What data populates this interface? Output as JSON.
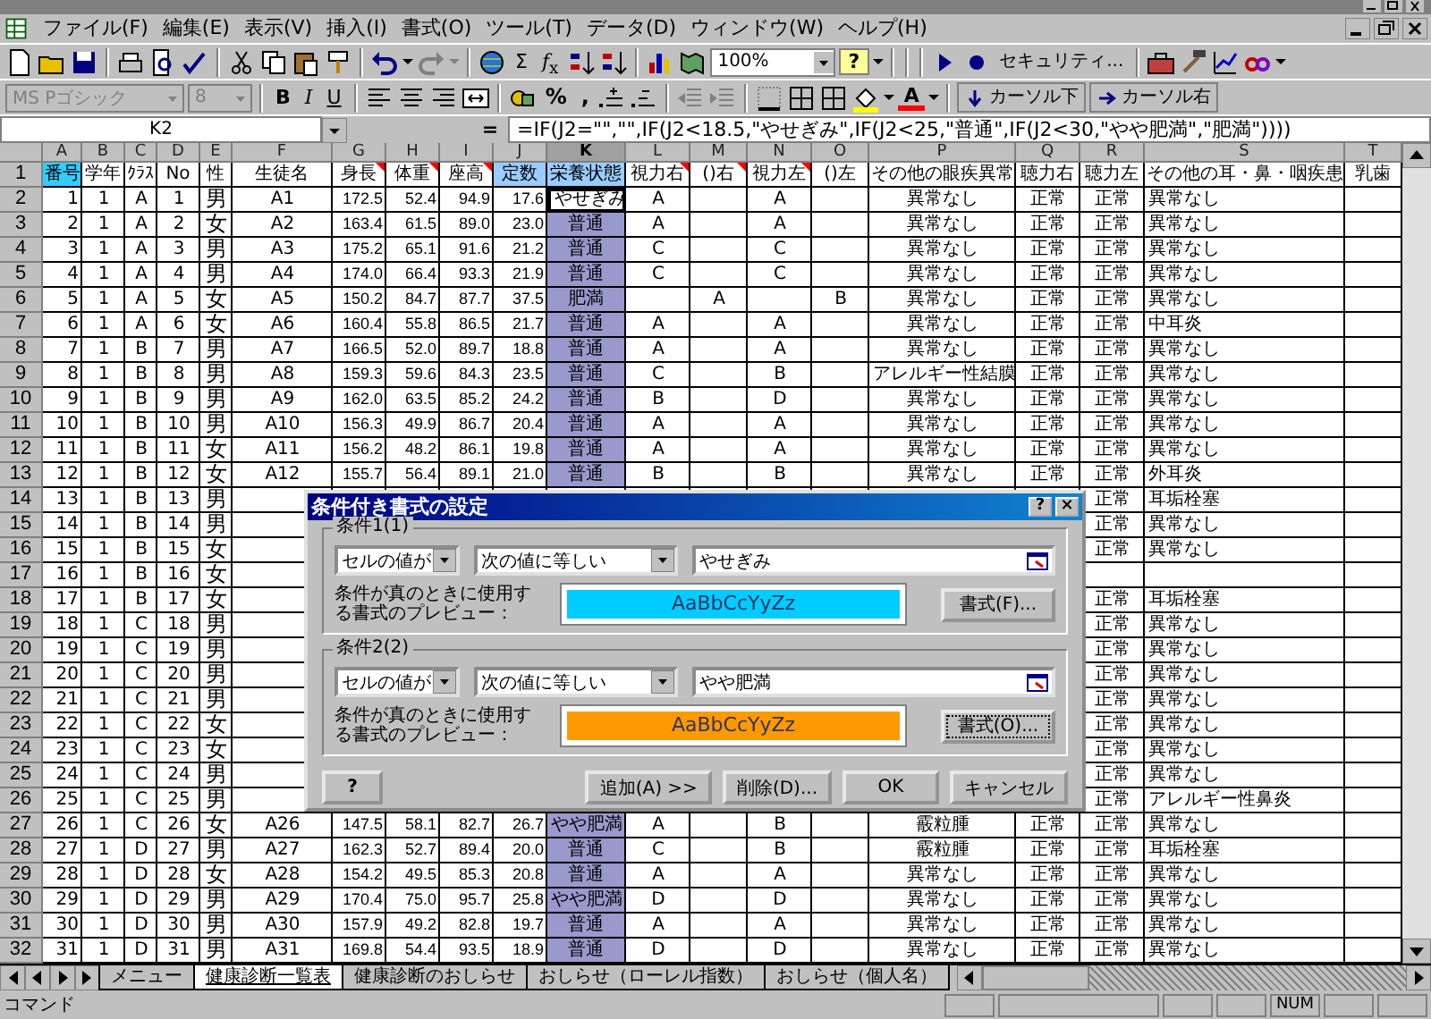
{
  "menu": [
    "ファイル(F)",
    "編集(E)",
    "表示(V)",
    "挿入(I)",
    "書式(O)",
    "ツール(T)",
    "データ(D)",
    "ウィンドウ(W)",
    "ヘルプ(H)"
  ],
  "toolbar": {
    "sum": "Σ",
    "function": "*f*$_{x}$",
    "zoom": "100%",
    "help": "?",
    "security": "セキュリティ..."
  },
  "format_bar": {
    "font": "MS Pゴシック",
    "size": "8",
    "disabled": true,
    "styles": [
      "B",
      "I",
      "U"
    ],
    "percent": "%",
    "comma": ",",
    "font_color": "A",
    "cursor_down": "カーソル下",
    "cursor_right": "カーソル右"
  },
  "formula_bar": {
    "name_box": "K2",
    "equals": "=",
    "formula": "=IF(J2=\"\",\"\",IF(J2<18.5,\"やせぎみ\",IF(J2<25,\"普通\",IF(J2<30,\"やや肥満\",\"肥満\"))))"
  },
  "columns": [
    {
      "letter": "A",
      "selected": false,
      "note": false,
      "color": "#33ccff"
    },
    {
      "letter": "B",
      "selected": false,
      "note": false
    },
    {
      "letter": "C",
      "selected": false,
      "note": false
    },
    {
      "letter": "D",
      "selected": false,
      "note": false
    },
    {
      "letter": "E",
      "selected": false,
      "note": false
    },
    {
      "letter": "F",
      "selected": false,
      "note": false
    },
    {
      "letter": "G",
      "selected": false,
      "note": true
    },
    {
      "letter": "H",
      "selected": false,
      "note": true
    },
    {
      "letter": "I",
      "selected": false,
      "note": true
    },
    {
      "letter": "J",
      "selected": false,
      "note": false,
      "color": "#99ccff"
    },
    {
      "letter": "K",
      "selected": true,
      "note": false,
      "color": "#99ccff"
    },
    {
      "letter": "L",
      "selected": false,
      "note": true
    },
    {
      "letter": "M",
      "selected": false,
      "note": true
    },
    {
      "letter": "N",
      "selected": false,
      "note": true
    },
    {
      "letter": "O",
      "selected": false,
      "note": false
    },
    {
      "letter": "P",
      "selected": false,
      "note": false
    },
    {
      "letter": "Q",
      "selected": false,
      "note": false
    },
    {
      "letter": "R",
      "selected": false,
      "note": false
    },
    {
      "letter": "S",
      "selected": false,
      "note": false
    },
    {
      "letter": "T",
      "selected": false,
      "note": false
    }
  ],
  "rows": [
    {
      "kind": "header",
      "number": "1",
      "cells": [
        {
          "text": "番号",
          "active": false
        },
        {
          "text": "学年",
          "active": false
        },
        {
          "text": "ｸﾗｽ",
          "active": false
        },
        {
          "text": "No",
          "active": false
        },
        {
          "text": "性",
          "active": false
        },
        {
          "text": "生徒名",
          "active": false
        },
        {
          "text": "身長",
          "active": false
        },
        {
          "text": "体重",
          "active": false
        },
        {
          "text": "座高",
          "active": false
        },
        {
          "text": "定数",
          "active": false
        },
        {
          "text": "栄養状態",
          "active": false
        },
        {
          "text": "視力右",
          "active": false
        },
        {
          "text": "()右",
          "active": false
        },
        {
          "text": "視力左",
          "active": false
        },
        {
          "text": "()左",
          "active": false
        },
        {
          "text": "その他の眼疾異常",
          "active": false
        },
        {
          "text": "聴力右",
          "active": false
        },
        {
          "text": "聴力左",
          "active": false
        },
        {
          "text": "その他の耳・鼻・咽疾患",
          "active": false
        },
        {
          "text": "乳歯",
          "active": false
        }
      ]
    },
    {
      "kind": "data",
      "number": "2",
      "cells": [
        {
          "text": "1",
          "active": false
        },
        {
          "text": "1",
          "active": false
        },
        {
          "text": "A",
          "active": false
        },
        {
          "text": "1",
          "active": false
        },
        {
          "text": "男",
          "active": false
        },
        {
          "text": "A1",
          "active": false
        },
        {
          "text": "172.5",
          "active": false
        },
        {
          "text": "52.4",
          "active": false
        },
        {
          "text": "94.9",
          "active": false
        },
        {
          "text": "17.6",
          "active": false
        },
        {
          "text": "やせぎみ",
          "active": true
        },
        {
          "text": "A",
          "active": false
        },
        null,
        {
          "text": "A",
          "active": false
        },
        null,
        {
          "text": "異常なし",
          "active": false
        },
        {
          "text": "正常",
          "active": false
        },
        {
          "text": "正常",
          "active": false
        },
        {
          "text": "異常なし",
          "active": false
        },
        null
      ]
    },
    {
      "kind": "data",
      "number": "3",
      "cells": [
        {
          "text": "2",
          "active": false
        },
        {
          "text": "1",
          "active": false
        },
        {
          "text": "A",
          "active": false
        },
        {
          "text": "2",
          "active": false
        },
        {
          "text": "女",
          "active": false
        },
        {
          "text": "A2",
          "active": false
        },
        {
          "text": "163.4",
          "active": false
        },
        {
          "text": "61.5",
          "active": false
        },
        {
          "text": "89.0",
          "active": false
        },
        {
          "text": "23.0",
          "active": false
        },
        {
          "text": "普通",
          "active": false
        },
        {
          "text": "A",
          "active": false
        },
        null,
        {
          "text": "A",
          "active": false
        },
        null,
        {
          "text": "異常なし",
          "active": false
        },
        {
          "text": "正常",
          "active": false
        },
        {
          "text": "正常",
          "active": false
        },
        {
          "text": "異常なし",
          "active": false
        },
        null
      ]
    },
    {
      "kind": "data",
      "number": "4",
      "cells": [
        {
          "text": "3",
          "active": false
        },
        {
          "text": "1",
          "active": false
        },
        {
          "text": "A",
          "active": false
        },
        {
          "text": "3",
          "active": false
        },
        {
          "text": "男",
          "active": false
        },
        {
          "text": "A3",
          "active": false
        },
        {
          "text": "175.2",
          "active": false
        },
        {
          "text": "65.1",
          "active": false
        },
        {
          "text": "91.6",
          "active": false
        },
        {
          "text": "21.2",
          "active": false
        },
        {
          "text": "普通",
          "active": false
        },
        {
          "text": "C",
          "active": false
        },
        null,
        {
          "text": "C",
          "active": false
        },
        null,
        {
          "text": "異常なし",
          "active": false
        },
        {
          "text": "正常",
          "active": false
        },
        {
          "text": "正常",
          "active": false
        },
        {
          "text": "異常なし",
          "active": false
        },
        null
      ]
    },
    {
      "kind": "data",
      "number": "5",
      "cells": [
        {
          "text": "4",
          "active": false
        },
        {
          "text": "1",
          "active": false
        },
        {
          "text": "A",
          "active": false
        },
        {
          "text": "4",
          "active": false
        },
        {
          "text": "男",
          "active": false
        },
        {
          "text": "A4",
          "active": false
        },
        {
          "text": "174.0",
          "active": false
        },
        {
          "text": "66.4",
          "active": false
        },
        {
          "text": "93.3",
          "active": false
        },
        {
          "text": "21.9",
          "active": false
        },
        {
          "text": "普通",
          "active": false
        },
        {
          "text": "C",
          "active": false
        },
        null,
        {
          "text": "C",
          "active": false
        },
        null,
        {
          "text": "異常なし",
          "active": false
        },
        {
          "text": "正常",
          "active": false
        },
        {
          "text": "正常",
          "active": false
        },
        {
          "text": "異常なし",
          "active": false
        },
        null
      ]
    },
    {
      "kind": "data",
      "number": "6",
      "cells": [
        {
          "text": "5",
          "active": false
        },
        {
          "text": "1",
          "active": false
        },
        {
          "text": "A",
          "active": false
        },
        {
          "text": "5",
          "active": false
        },
        {
          "text": "女",
          "active": false
        },
        {
          "text": "A5",
          "active": false
        },
        {
          "text": "150.2",
          "active": false
        },
        {
          "text": "84.7",
          "active": false
        },
        {
          "text": "87.7",
          "active": false
        },
        {
          "text": "37.5",
          "active": false
        },
        {
          "text": "肥満",
          "active": false
        },
        null,
        {
          "text": "A",
          "active": false
        },
        null,
        {
          "text": "B",
          "active": false
        },
        {
          "text": "異常なし",
          "active": false
        },
        {
          "text": "正常",
          "active": false
        },
        {
          "text": "正常",
          "active": false
        },
        {
          "text": "異常なし",
          "active": false
        },
        null
      ]
    },
    {
      "kind": "data",
      "number": "7",
      "cells": [
        {
          "text": "6",
          "active": false
        },
        {
          "text": "1",
          "active": false
        },
        {
          "text": "A",
          "active": false
        },
        {
          "text": "6",
          "active": false
        },
        {
          "text": "女",
          "active": false
        },
        {
          "text": "A6",
          "active": false
        },
        {
          "text": "160.4",
          "active": false
        },
        {
          "text": "55.8",
          "active": false
        },
        {
          "text": "86.5",
          "active": false
        },
        {
          "text": "21.7",
          "active": false
        },
        {
          "text": "普通",
          "active": false
        },
        {
          "text": "A",
          "active": false
        },
        null,
        {
          "text": "A",
          "active": false
        },
        null,
        {
          "text": "異常なし",
          "active": false
        },
        {
          "text": "正常",
          "active": false
        },
        {
          "text": "正常",
          "active": false
        },
        {
          "text": "中耳炎",
          "active": false
        },
        null
      ]
    },
    {
      "kind": "data",
      "number": "8",
      "cells": [
        {
          "text": "7",
          "active": false
        },
        {
          "text": "1",
          "active": false
        },
        {
          "text": "B",
          "active": false
        },
        {
          "text": "7",
          "active": false
        },
        {
          "text": "男",
          "active": false
        },
        {
          "text": "A7",
          "active": false
        },
        {
          "text": "166.5",
          "active": false
        },
        {
          "text": "52.0",
          "active": false
        },
        {
          "text": "89.7",
          "active": false
        },
        {
          "text": "18.8",
          "active": false
        },
        {
          "text": "普通",
          "active": false
        },
        {
          "text": "A",
          "active": false
        },
        null,
        {
          "text": "A",
          "active": false
        },
        null,
        {
          "text": "異常なし",
          "active": false
        },
        {
          "text": "正常",
          "active": false
        },
        {
          "text": "正常",
          "active": false
        },
        {
          "text": "異常なし",
          "active": false
        },
        null
      ]
    },
    {
      "kind": "data",
      "number": "9",
      "cells": [
        {
          "text": "8",
          "active": false
        },
        {
          "text": "1",
          "active": false
        },
        {
          "text": "B",
          "active": false
        },
        {
          "text": "8",
          "active": false
        },
        {
          "text": "男",
          "active": false
        },
        {
          "text": "A8",
          "active": false
        },
        {
          "text": "159.3",
          "active": false
        },
        {
          "text": "59.6",
          "active": false
        },
        {
          "text": "84.3",
          "active": false
        },
        {
          "text": "23.5",
          "active": false
        },
        {
          "text": "普通",
          "active": false
        },
        {
          "text": "C",
          "active": false
        },
        null,
        {
          "text": "B",
          "active": false
        },
        null,
        {
          "text": "アレルギー性結膜",
          "active": false
        },
        {
          "text": "正常",
          "active": false
        },
        {
          "text": "正常",
          "active": false
        },
        {
          "text": "異常なし",
          "active": false
        },
        null
      ]
    },
    {
      "kind": "data",
      "number": "10",
      "cells": [
        {
          "text": "9",
          "active": false
        },
        {
          "text": "1",
          "active": false
        },
        {
          "text": "B",
          "active": false
        },
        {
          "text": "9",
          "active": false
        },
        {
          "text": "男",
          "active": false
        },
        {
          "text": "A9",
          "active": false
        },
        {
          "text": "162.0",
          "active": false
        },
        {
          "text": "63.5",
          "active": false
        },
        {
          "text": "85.2",
          "active": false
        },
        {
          "text": "24.2",
          "active": false
        },
        {
          "text": "普通",
          "active": false
        },
        {
          "text": "B",
          "active": false
        },
        null,
        {
          "text": "D",
          "active": false
        },
        null,
        {
          "text": "異常なし",
          "active": false
        },
        {
          "text": "正常",
          "active": false
        },
        {
          "text": "正常",
          "active": false
        },
        {
          "text": "異常なし",
          "active": false
        },
        null
      ]
    },
    {
      "kind": "data",
      "number": "11",
      "cells": [
        {
          "text": "10",
          "active": false
        },
        {
          "text": "1",
          "active": false
        },
        {
          "text": "B",
          "active": false
        },
        {
          "text": "10",
          "active": false
        },
        {
          "text": "男",
          "active": false
        },
        {
          "text": "A10",
          "active": false
        },
        {
          "text": "156.3",
          "active": false
        },
        {
          "text": "49.9",
          "active": false
        },
        {
          "text": "86.7",
          "active": false
        },
        {
          "text": "20.4",
          "active": false
        },
        {
          "text": "普通",
          "active": false
        },
        {
          "text": "A",
          "active": false
        },
        null,
        {
          "text": "A",
          "active": false
        },
        null,
        {
          "text": "異常なし",
          "active": false
        },
        {
          "text": "正常",
          "active": false
        },
        {
          "text": "正常",
          "active": false
        },
        {
          "text": "異常なし",
          "active": false
        },
        null
      ]
    },
    {
      "kind": "data",
      "number": "12",
      "cells": [
        {
          "text": "11",
          "active": false
        },
        {
          "text": "1",
          "active": false
        },
        {
          "text": "B",
          "active": false
        },
        {
          "text": "11",
          "active": false
        },
        {
          "text": "女",
          "active": false
        },
        {
          "text": "A11",
          "active": false
        },
        {
          "text": "156.2",
          "active": false
        },
        {
          "text": "48.2",
          "active": false
        },
        {
          "text": "86.1",
          "active": false
        },
        {
          "text": "19.8",
          "active": false
        },
        {
          "text": "普通",
          "active": false
        },
        {
          "text": "A",
          "active": false
        },
        null,
        {
          "text": "A",
          "active": false
        },
        null,
        {
          "text": "異常なし",
          "active": false
        },
        {
          "text": "正常",
          "active": false
        },
        {
          "text": "正常",
          "active": false
        },
        {
          "text": "異常なし",
          "active": false
        },
        null
      ]
    },
    {
      "kind": "data",
      "number": "13",
      "cells": [
        {
          "text": "12",
          "active": false
        },
        {
          "text": "1",
          "active": false
        },
        {
          "text": "B",
          "active": false
        },
        {
          "text": "12",
          "active": false
        },
        {
          "text": "女",
          "active": false
        },
        {
          "text": "A12",
          "active": false
        },
        {
          "text": "155.7",
          "active": false
        },
        {
          "text": "56.4",
          "active": false
        },
        {
          "text": "89.1",
          "active": false
        },
        {
          "text": "21.0",
          "active": false
        },
        {
          "text": "普通",
          "active": false
        },
        {
          "text": "B",
          "active": false
        },
        null,
        {
          "text": "B",
          "active": false
        },
        null,
        {
          "text": "異常なし",
          "active": false
        },
        {
          "text": "正常",
          "active": false
        },
        {
          "text": "正常",
          "active": false
        },
        {
          "text": "外耳炎",
          "active": false
        },
        null
      ]
    },
    {
      "kind": "data",
      "number": "14",
      "cells": [
        {
          "text": "13",
          "active": false
        },
        {
          "text": "1",
          "active": false
        },
        {
          "text": "B",
          "active": false
        },
        {
          "text": "13",
          "active": false
        },
        {
          "text": "男",
          "active": false
        },
        null,
        null,
        null,
        null,
        null,
        null,
        null,
        null,
        null,
        null,
        null,
        null,
        {
          "text": "正常",
          "active": false
        },
        {
          "text": "耳垢栓塞",
          "active": false
        },
        null
      ]
    },
    {
      "kind": "data",
      "number": "15",
      "cells": [
        {
          "text": "14",
          "active": false
        },
        {
          "text": "1",
          "active": false
        },
        {
          "text": "B",
          "active": false
        },
        {
          "text": "14",
          "active": false
        },
        {
          "text": "男",
          "active": false
        },
        null,
        null,
        null,
        null,
        null,
        null,
        null,
        null,
        null,
        null,
        null,
        null,
        {
          "text": "正常",
          "active": false
        },
        {
          "text": "異常なし",
          "active": false
        },
        null
      ]
    },
    {
      "kind": "data",
      "number": "16",
      "cells": [
        {
          "text": "15",
          "active": false
        },
        {
          "text": "1",
          "active": false
        },
        {
          "text": "B",
          "active": false
        },
        {
          "text": "15",
          "active": false
        },
        {
          "text": "女",
          "active": false
        },
        null,
        null,
        null,
        null,
        null,
        null,
        null,
        null,
        null,
        null,
        null,
        null,
        {
          "text": "正常",
          "active": false
        },
        {
          "text": "異常なし",
          "active": false
        },
        null
      ]
    },
    {
      "kind": "data",
      "number": "17",
      "cells": [
        {
          "text": "16",
          "active": false
        },
        {
          "text": "1",
          "active": false
        },
        {
          "text": "B",
          "active": false
        },
        {
          "text": "16",
          "active": false
        },
        {
          "text": "女",
          "active": false
        },
        null,
        null,
        null,
        null,
        null,
        null,
        null,
        null,
        null,
        null,
        null,
        null,
        null,
        null,
        null
      ]
    },
    {
      "kind": "data",
      "number": "18",
      "cells": [
        {
          "text": "17",
          "active": false
        },
        {
          "text": "1",
          "active": false
        },
        {
          "text": "B",
          "active": false
        },
        {
          "text": "17",
          "active": false
        },
        {
          "text": "女",
          "active": false
        },
        null,
        null,
        null,
        null,
        null,
        null,
        null,
        null,
        null,
        null,
        null,
        null,
        {
          "text": "正常",
          "active": false
        },
        {
          "text": "耳垢栓塞",
          "active": false
        },
        null
      ]
    },
    {
      "kind": "data",
      "number": "19",
      "cells": [
        {
          "text": "18",
          "active": false
        },
        {
          "text": "1",
          "active": false
        },
        {
          "text": "C",
          "active": false
        },
        {
          "text": "18",
          "active": false
        },
        {
          "text": "男",
          "active": false
        },
        null,
        null,
        null,
        null,
        null,
        null,
        null,
        null,
        null,
        null,
        null,
        null,
        {
          "text": "正常",
          "active": false
        },
        {
          "text": "異常なし",
          "active": false
        },
        null
      ]
    },
    {
      "kind": "data",
      "number": "20",
      "cells": [
        {
          "text": "19",
          "active": false
        },
        {
          "text": "1",
          "active": false
        },
        {
          "text": "C",
          "active": false
        },
        {
          "text": "19",
          "active": false
        },
        {
          "text": "男",
          "active": false
        },
        null,
        null,
        null,
        null,
        null,
        null,
        null,
        null,
        null,
        null,
        null,
        null,
        {
          "text": "正常",
          "active": false
        },
        {
          "text": "異常なし",
          "active": false
        },
        null
      ]
    },
    {
      "kind": "data",
      "number": "21",
      "cells": [
        {
          "text": "20",
          "active": false
        },
        {
          "text": "1",
          "active": false
        },
        {
          "text": "C",
          "active": false
        },
        {
          "text": "20",
          "active": false
        },
        {
          "text": "男",
          "active": false
        },
        null,
        null,
        null,
        null,
        null,
        null,
        null,
        null,
        null,
        null,
        null,
        null,
        {
          "text": "正常",
          "active": false
        },
        {
          "text": "異常なし",
          "active": false
        },
        null
      ]
    },
    {
      "kind": "data",
      "number": "22",
      "cells": [
        {
          "text": "21",
          "active": false
        },
        {
          "text": "1",
          "active": false
        },
        {
          "text": "C",
          "active": false
        },
        {
          "text": "21",
          "active": false
        },
        {
          "text": "男",
          "active": false
        },
        null,
        null,
        null,
        null,
        null,
        null,
        null,
        null,
        null,
        null,
        null,
        null,
        {
          "text": "正常",
          "active": false
        },
        {
          "text": "異常なし",
          "active": false
        },
        null
      ]
    },
    {
      "kind": "data",
      "number": "23",
      "cells": [
        {
          "text": "22",
          "active": false
        },
        {
          "text": "1",
          "active": false
        },
        {
          "text": "C",
          "active": false
        },
        {
          "text": "22",
          "active": false
        },
        {
          "text": "女",
          "active": false
        },
        null,
        null,
        null,
        null,
        null,
        null,
        null,
        null,
        null,
        null,
        null,
        null,
        {
          "text": "正常",
          "active": false
        },
        {
          "text": "異常なし",
          "active": false
        },
        null
      ]
    },
    {
      "kind": "data",
      "number": "24",
      "cells": [
        {
          "text": "23",
          "active": false
        },
        {
          "text": "1",
          "active": false
        },
        {
          "text": "C",
          "active": false
        },
        {
          "text": "23",
          "active": false
        },
        {
          "text": "女",
          "active": false
        },
        null,
        null,
        null,
        null,
        null,
        null,
        null,
        null,
        null,
        null,
        null,
        null,
        {
          "text": "正常",
          "active": false
        },
        {
          "text": "異常なし",
          "active": false
        },
        null
      ]
    },
    {
      "kind": "data",
      "number": "25",
      "cells": [
        {
          "text": "24",
          "active": false
        },
        {
          "text": "1",
          "active": false
        },
        {
          "text": "C",
          "active": false
        },
        {
          "text": "24",
          "active": false
        },
        {
          "text": "男",
          "active": false
        },
        null,
        null,
        null,
        null,
        null,
        null,
        null,
        null,
        null,
        null,
        null,
        null,
        {
          "text": "正常",
          "active": false
        },
        {
          "text": "異常なし",
          "active": false
        },
        null
      ]
    },
    {
      "kind": "data",
      "number": "26",
      "cells": [
        {
          "text": "25",
          "active": false
        },
        {
          "text": "1",
          "active": false
        },
        {
          "text": "C",
          "active": false
        },
        {
          "text": "25",
          "active": false
        },
        {
          "text": "男",
          "active": false
        },
        null,
        null,
        null,
        null,
        null,
        null,
        null,
        null,
        null,
        null,
        null,
        null,
        {
          "text": "正常",
          "active": false
        },
        {
          "text": "アレルギー性鼻炎",
          "active": false
        },
        null
      ]
    },
    {
      "kind": "data",
      "number": "27",
      "cells": [
        {
          "text": "26",
          "active": false
        },
        {
          "text": "1",
          "active": false
        },
        {
          "text": "C",
          "active": false
        },
        {
          "text": "26",
          "active": false
        },
        {
          "text": "女",
          "active": false
        },
        {
          "text": "A26",
          "active": false
        },
        {
          "text": "147.5",
          "active": false
        },
        {
          "text": "58.1",
          "active": false
        },
        {
          "text": "82.7",
          "active": false
        },
        {
          "text": "26.7",
          "active": false
        },
        {
          "text": "やや肥満",
          "active": false
        },
        {
          "text": "A",
          "active": false
        },
        null,
        {
          "text": "B",
          "active": false
        },
        null,
        {
          "text": "霰粒腫",
          "active": false
        },
        {
          "text": "正常",
          "active": false
        },
        {
          "text": "正常",
          "active": false
        },
        {
          "text": "異常なし",
          "active": false
        },
        null
      ]
    },
    {
      "kind": "data",
      "number": "28",
      "cells": [
        {
          "text": "27",
          "active": false
        },
        {
          "text": "1",
          "active": false
        },
        {
          "text": "D",
          "active": false
        },
        {
          "text": "27",
          "active": false
        },
        {
          "text": "男",
          "active": false
        },
        {
          "text": "A27",
          "active": false
        },
        {
          "text": "162.3",
          "active": false
        },
        {
          "text": "52.7",
          "active": false
        },
        {
          "text": "89.4",
          "active": false
        },
        {
          "text": "20.0",
          "active": false
        },
        {
          "text": "普通",
          "active": false
        },
        {
          "text": "C",
          "active": false
        },
        null,
        {
          "text": "B",
          "active": false
        },
        null,
        {
          "text": "霰粒腫",
          "active": false
        },
        {
          "text": "正常",
          "active": false
        },
        {
          "text": "正常",
          "active": false
        },
        {
          "text": "耳垢栓塞",
          "active": false
        },
        null
      ]
    },
    {
      "kind": "data",
      "number": "29",
      "cells": [
        {
          "text": "28",
          "active": false
        },
        {
          "text": "1",
          "active": false
        },
        {
          "text": "D",
          "active": false
        },
        {
          "text": "28",
          "active": false
        },
        {
          "text": "女",
          "active": false
        },
        {
          "text": "A28",
          "active": false
        },
        {
          "text": "154.2",
          "active": false
        },
        {
          "text": "49.5",
          "active": false
        },
        {
          "text": "85.3",
          "active": false
        },
        {
          "text": "20.8",
          "active": false
        },
        {
          "text": "普通",
          "active": false
        },
        {
          "text": "A",
          "active": false
        },
        null,
        {
          "text": "A",
          "active": false
        },
        null,
        {
          "text": "異常なし",
          "active": false
        },
        {
          "text": "正常",
          "active": false
        },
        {
          "text": "正常",
          "active": false
        },
        {
          "text": "異常なし",
          "active": false
        },
        null
      ]
    },
    {
      "kind": "data",
      "number": "30",
      "cells": [
        {
          "text": "29",
          "active": false
        },
        {
          "text": "1",
          "active": false
        },
        {
          "text": "D",
          "active": false
        },
        {
          "text": "29",
          "active": false
        },
        {
          "text": "男",
          "active": false
        },
        {
          "text": "A29",
          "active": false
        },
        {
          "text": "170.4",
          "active": false
        },
        {
          "text": "75.0",
          "active": false
        },
        {
          "text": "95.7",
          "active": false
        },
        {
          "text": "25.8",
          "active": false
        },
        {
          "text": "やや肥満",
          "active": false
        },
        {
          "text": "D",
          "active": false
        },
        null,
        {
          "text": "D",
          "active": false
        },
        null,
        {
          "text": "異常なし",
          "active": false
        },
        {
          "text": "正常",
          "active": false
        },
        {
          "text": "正常",
          "active": false
        },
        {
          "text": "異常なし",
          "active": false
        },
        null
      ]
    },
    {
      "kind": "data",
      "number": "31",
      "cells": [
        {
          "text": "30",
          "active": false
        },
        {
          "text": "1",
          "active": false
        },
        {
          "text": "D",
          "active": false
        },
        {
          "text": "30",
          "active": false
        },
        {
          "text": "男",
          "active": false
        },
        {
          "text": "A30",
          "active": false
        },
        {
          "text": "157.9",
          "active": false
        },
        {
          "text": "49.2",
          "active": false
        },
        {
          "text": "82.8",
          "active": false
        },
        {
          "text": "19.7",
          "active": false
        },
        {
          "text": "普通",
          "active": false
        },
        {
          "text": "A",
          "active": false
        },
        null,
        {
          "text": "A",
          "active": false
        },
        null,
        {
          "text": "異常なし",
          "active": false
        },
        {
          "text": "正常",
          "active": false
        },
        {
          "text": "正常",
          "active": false
        },
        {
          "text": "異常なし",
          "active": false
        },
        null
      ]
    },
    {
      "kind": "data",
      "number": "32",
      "cells": [
        {
          "text": "31",
          "active": false
        },
        {
          "text": "1",
          "active": false
        },
        {
          "text": "D",
          "active": false
        },
        {
          "text": "31",
          "active": false
        },
        {
          "text": "男",
          "active": false
        },
        {
          "text": "A31",
          "active": false
        },
        {
          "text": "169.8",
          "active": false
        },
        {
          "text": "54.4",
          "active": false
        },
        {
          "text": "93.5",
          "active": false
        },
        {
          "text": "18.9",
          "active": false
        },
        {
          "text": "普通",
          "active": false
        },
        {
          "text": "D",
          "active": false
        },
        null,
        {
          "text": "D",
          "active": false
        },
        null,
        {
          "text": "異常なし",
          "active": false
        },
        {
          "text": "正常",
          "active": false
        },
        {
          "text": "正常",
          "active": false
        },
        {
          "text": "異常なし",
          "active": false
        },
        null
      ]
    }
  ],
  "dialog": {
    "title": "条件付き書式の設定",
    "help": "?",
    "close": "×",
    "help_button": "?",
    "buttons": [
      "追加(A) >>",
      "削除(D)...",
      "OK",
      "キャンセル"
    ],
    "conditions": [
      {
        "legend": "条件1(1)",
        "operand": "セルの値が",
        "operator": "次の値に等しい",
        "value": "やせぎみ",
        "preview_label": "条件が真のときに使用する書式のプレビュー：",
        "preview_text": "AaBbCcYyZz",
        "color": "#00ccff",
        "format_button": "書式(F)...",
        "focused": false
      },
      {
        "legend": "条件2(2)",
        "operand": "セルの値が",
        "operator": "次の値に等しい",
        "value": "やや肥満",
        "preview_label": "条件が真のときに使用する書式のプレビュー：",
        "preview_text": "AaBbCcYyZz",
        "color": "#ff9900",
        "format_button": "書式(O)...",
        "focused": true
      }
    ]
  },
  "sheet_tabs": [
    {
      "label": "メニュー",
      "selected": false
    },
    {
      "label": "健康診断一覧表",
      "selected": true
    },
    {
      "label": "健康診断のおしらせ",
      "selected": false
    },
    {
      "label": "おしらせ（ローレル指数）",
      "selected": false
    },
    {
      "label": "おしらせ（個人名）",
      "selected": false
    }
  ],
  "status_bar": {
    "mode": "コマンド",
    "num": "NUM"
  }
}
